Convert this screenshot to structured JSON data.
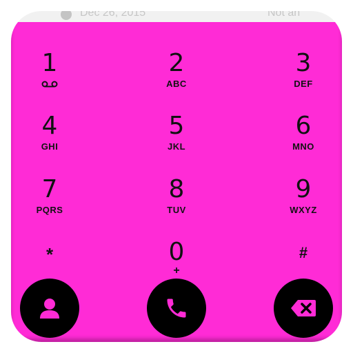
{
  "status_bar": {
    "date": "Dec 26, 2015",
    "right_text": "Not an"
  },
  "dialpad": {
    "background_color": "#ff2bd6",
    "keys": [
      {
        "digit": "1",
        "letters": "",
        "extra_icon": "voicemail-icon"
      },
      {
        "digit": "2",
        "letters": "ABC"
      },
      {
        "digit": "3",
        "letters": "DEF"
      },
      {
        "digit": "4",
        "letters": "GHI"
      },
      {
        "digit": "5",
        "letters": "JKL"
      },
      {
        "digit": "6",
        "letters": "MNO"
      },
      {
        "digit": "7",
        "letters": "PQRS"
      },
      {
        "digit": "8",
        "letters": "TUV"
      },
      {
        "digit": "9",
        "letters": "WXYZ"
      },
      {
        "digit": "*",
        "letters": ""
      },
      {
        "digit": "0",
        "letters": "+"
      },
      {
        "digit": "#",
        "letters": ""
      }
    ]
  },
  "actions": {
    "contacts_icon": "person-icon",
    "call_icon": "phone-icon",
    "delete_icon": "backspace-icon"
  }
}
